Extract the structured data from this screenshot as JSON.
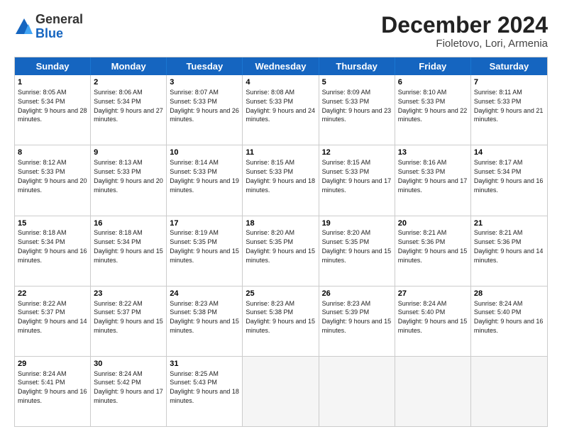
{
  "logo": {
    "general": "General",
    "blue": "Blue"
  },
  "header": {
    "month": "December 2024",
    "location": "Fioletovo, Lori, Armenia"
  },
  "days": [
    "Sunday",
    "Monday",
    "Tuesday",
    "Wednesday",
    "Thursday",
    "Friday",
    "Saturday"
  ],
  "weeks": [
    [
      {
        "day": "1",
        "sunrise": "8:05 AM",
        "sunset": "5:34 PM",
        "daylight": "9 hours and 28 minutes"
      },
      {
        "day": "2",
        "sunrise": "8:06 AM",
        "sunset": "5:34 PM",
        "daylight": "9 hours and 27 minutes"
      },
      {
        "day": "3",
        "sunrise": "8:07 AM",
        "sunset": "5:33 PM",
        "daylight": "9 hours and 26 minutes"
      },
      {
        "day": "4",
        "sunrise": "8:08 AM",
        "sunset": "5:33 PM",
        "daylight": "9 hours and 24 minutes"
      },
      {
        "day": "5",
        "sunrise": "8:09 AM",
        "sunset": "5:33 PM",
        "daylight": "9 hours and 23 minutes"
      },
      {
        "day": "6",
        "sunrise": "8:10 AM",
        "sunset": "5:33 PM",
        "daylight": "9 hours and 22 minutes"
      },
      {
        "day": "7",
        "sunrise": "8:11 AM",
        "sunset": "5:33 PM",
        "daylight": "9 hours and 21 minutes"
      }
    ],
    [
      {
        "day": "8",
        "sunrise": "8:12 AM",
        "sunset": "5:33 PM",
        "daylight": "9 hours and 20 minutes"
      },
      {
        "day": "9",
        "sunrise": "8:13 AM",
        "sunset": "5:33 PM",
        "daylight": "9 hours and 20 minutes"
      },
      {
        "day": "10",
        "sunrise": "8:14 AM",
        "sunset": "5:33 PM",
        "daylight": "9 hours and 19 minutes"
      },
      {
        "day": "11",
        "sunrise": "8:15 AM",
        "sunset": "5:33 PM",
        "daylight": "9 hours and 18 minutes"
      },
      {
        "day": "12",
        "sunrise": "8:15 AM",
        "sunset": "5:33 PM",
        "daylight": "9 hours and 17 minutes"
      },
      {
        "day": "13",
        "sunrise": "8:16 AM",
        "sunset": "5:33 PM",
        "daylight": "9 hours and 17 minutes"
      },
      {
        "day": "14",
        "sunrise": "8:17 AM",
        "sunset": "5:34 PM",
        "daylight": "9 hours and 16 minutes"
      }
    ],
    [
      {
        "day": "15",
        "sunrise": "8:18 AM",
        "sunset": "5:34 PM",
        "daylight": "9 hours and 16 minutes"
      },
      {
        "day": "16",
        "sunrise": "8:18 AM",
        "sunset": "5:34 PM",
        "daylight": "9 hours and 15 minutes"
      },
      {
        "day": "17",
        "sunrise": "8:19 AM",
        "sunset": "5:35 PM",
        "daylight": "9 hours and 15 minutes"
      },
      {
        "day": "18",
        "sunrise": "8:20 AM",
        "sunset": "5:35 PM",
        "daylight": "9 hours and 15 minutes"
      },
      {
        "day": "19",
        "sunrise": "8:20 AM",
        "sunset": "5:35 PM",
        "daylight": "9 hours and 15 minutes"
      },
      {
        "day": "20",
        "sunrise": "8:21 AM",
        "sunset": "5:36 PM",
        "daylight": "9 hours and 15 minutes"
      },
      {
        "day": "21",
        "sunrise": "8:21 AM",
        "sunset": "5:36 PM",
        "daylight": "9 hours and 14 minutes"
      }
    ],
    [
      {
        "day": "22",
        "sunrise": "8:22 AM",
        "sunset": "5:37 PM",
        "daylight": "9 hours and 14 minutes"
      },
      {
        "day": "23",
        "sunrise": "8:22 AM",
        "sunset": "5:37 PM",
        "daylight": "9 hours and 15 minutes"
      },
      {
        "day": "24",
        "sunrise": "8:23 AM",
        "sunset": "5:38 PM",
        "daylight": "9 hours and 15 minutes"
      },
      {
        "day": "25",
        "sunrise": "8:23 AM",
        "sunset": "5:38 PM",
        "daylight": "9 hours and 15 minutes"
      },
      {
        "day": "26",
        "sunrise": "8:23 AM",
        "sunset": "5:39 PM",
        "daylight": "9 hours and 15 minutes"
      },
      {
        "day": "27",
        "sunrise": "8:24 AM",
        "sunset": "5:40 PM",
        "daylight": "9 hours and 15 minutes"
      },
      {
        "day": "28",
        "sunrise": "8:24 AM",
        "sunset": "5:40 PM",
        "daylight": "9 hours and 16 minutes"
      }
    ],
    [
      {
        "day": "29",
        "sunrise": "8:24 AM",
        "sunset": "5:41 PM",
        "daylight": "9 hours and 16 minutes"
      },
      {
        "day": "30",
        "sunrise": "8:24 AM",
        "sunset": "5:42 PM",
        "daylight": "9 hours and 17 minutes"
      },
      {
        "day": "31",
        "sunrise": "8:25 AM",
        "sunset": "5:43 PM",
        "daylight": "9 hours and 18 minutes"
      },
      null,
      null,
      null,
      null
    ]
  ]
}
